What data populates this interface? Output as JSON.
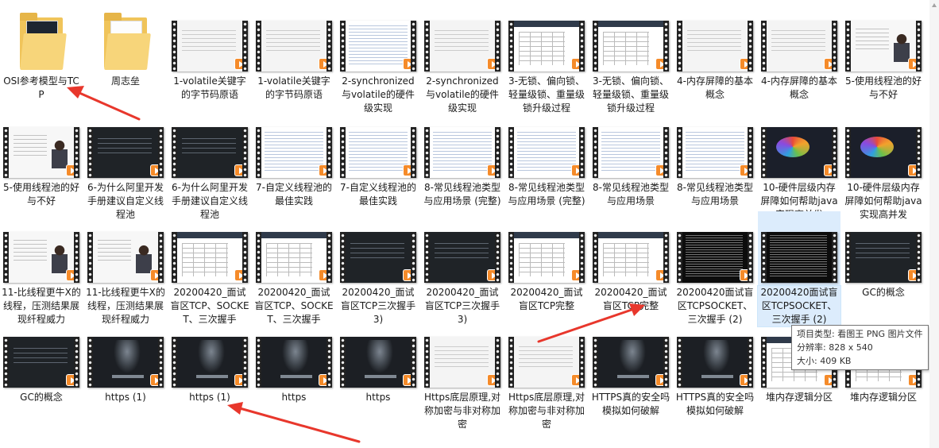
{
  "tooltip": {
    "type_line": "项目类型: 看图王 PNG 图片文件",
    "resolution_line": "分辨率: 828 x 540",
    "size_line": "大小: 409 KB"
  },
  "colors": {
    "annotation_red": "#e8372c",
    "selection": "#dcecfc",
    "play_badge": "#f58b2a"
  },
  "items": [
    {
      "name": "OSI参考模型与TCP",
      "kind": "folder",
      "folder_style": "dark"
    },
    {
      "name": "周志垒",
      "kind": "folder",
      "folder_style": "light"
    },
    {
      "name": "1-volatile关键字的字节码原语",
      "kind": "video",
      "thumb": "white"
    },
    {
      "name": "1-volatile关键字的字节码原语",
      "kind": "video",
      "thumb": "white"
    },
    {
      "name": "2-synchronized与volatile的硬件级实现",
      "kind": "video",
      "thumb": "code"
    },
    {
      "name": "2-synchronized与volatile的硬件级实现",
      "kind": "video",
      "thumb": "white"
    },
    {
      "name": "3-无锁、偏向锁、轻量级锁、重量级锁升级过程",
      "kind": "video",
      "thumb": "table"
    },
    {
      "name": "3-无锁、偏向锁、轻量级锁、重量级锁升级过程",
      "kind": "video",
      "thumb": "table"
    },
    {
      "name": "4-内存屏障的基本概念",
      "kind": "video",
      "thumb": "white"
    },
    {
      "name": "4-内存屏障的基本概念",
      "kind": "video",
      "thumb": "white"
    },
    {
      "name": "5-使用线程池的好与不好",
      "kind": "video",
      "thumb": "person"
    },
    {
      "name": "5-使用线程池的好与不好",
      "kind": "video",
      "thumb": "person"
    },
    {
      "name": "6-为什么阿里开发手册建议自定义线程池",
      "kind": "video",
      "thumb": "dark"
    },
    {
      "name": "6-为什么阿里开发手册建议自定义线程池",
      "kind": "video",
      "thumb": "dark"
    },
    {
      "name": "7-自定义线程池的最佳实践",
      "kind": "video",
      "thumb": "code"
    },
    {
      "name": "7-自定义线程池的最佳实践",
      "kind": "video",
      "thumb": "code"
    },
    {
      "name": "8-常见线程池类型与应用场景 (完整)",
      "kind": "video",
      "thumb": "code"
    },
    {
      "name": "8-常见线程池类型与应用场景 (完整)",
      "kind": "video",
      "thumb": "code"
    },
    {
      "name": "8-常见线程池类型与应用场景",
      "kind": "video",
      "thumb": "code"
    },
    {
      "name": "8-常见线程池类型与应用场景",
      "kind": "video",
      "thumb": "code"
    },
    {
      "name": "10-硬件层级内存屏障如何帮助java实现高并发",
      "kind": "video",
      "thumb": "colorful"
    },
    {
      "name": "10-硬件层级内存屏障如何帮助java实现高并发",
      "kind": "video",
      "thumb": "colorful"
    },
    {
      "name": "11-比线程更牛X的线程，压测结果展现纤程威力",
      "kind": "video",
      "thumb": "person"
    },
    {
      "name": "11-比线程更牛X的线程，压测结果展现纤程威力",
      "kind": "video",
      "thumb": "person"
    },
    {
      "name": "20200420_面试盲区TCP、SOCKET、三次握手",
      "kind": "video",
      "thumb": "table"
    },
    {
      "name": "20200420_面试盲区TCP、SOCKET、三次握手",
      "kind": "video",
      "thumb": "table"
    },
    {
      "name": "20200420_面试盲区TCP三次握手 3)",
      "kind": "video",
      "thumb": "dark"
    },
    {
      "name": "20200420_面试盲区TCP三次握手 3)",
      "kind": "video",
      "thumb": "dark"
    },
    {
      "name": "20200420_面试盲区TCP完整",
      "kind": "video",
      "thumb": "table"
    },
    {
      "name": "20200420_面试盲区TCP完整",
      "kind": "video",
      "thumb": "table"
    },
    {
      "name": "20200420面试盲区TCPSOCKET、三次握手 (2)",
      "kind": "video",
      "thumb": "terminal"
    },
    {
      "name": "20200420面试盲区TCPSOCKET、三次握手 (2)",
      "kind": "image",
      "thumb": "terminal",
      "selected": true
    },
    {
      "name": "GC的概念",
      "kind": "video",
      "thumb": "dark"
    },
    {
      "name": "GC的概念",
      "kind": "video",
      "thumb": "dark"
    },
    {
      "name": "https (1)",
      "kind": "video",
      "thumb": "https"
    },
    {
      "name": "https (1)",
      "kind": "video",
      "thumb": "https"
    },
    {
      "name": "https",
      "kind": "video",
      "thumb": "https"
    },
    {
      "name": "https",
      "kind": "video",
      "thumb": "https"
    },
    {
      "name": "Https底层原理,对称加密与非对称加密",
      "kind": "video",
      "thumb": "white"
    },
    {
      "name": "Https底层原理,对称加密与非对称加密",
      "kind": "video",
      "thumb": "white"
    },
    {
      "name": "HTTPS真的安全吗模拟如何破解",
      "kind": "video",
      "thumb": "https"
    },
    {
      "name": "HTTPS真的安全吗模拟如何破解",
      "kind": "video",
      "thumb": "https"
    },
    {
      "name": "堆内存逻辑分区",
      "kind": "video",
      "thumb": "table"
    },
    {
      "name": "堆内存逻辑分区",
      "kind": "video",
      "thumb": "table"
    }
  ]
}
